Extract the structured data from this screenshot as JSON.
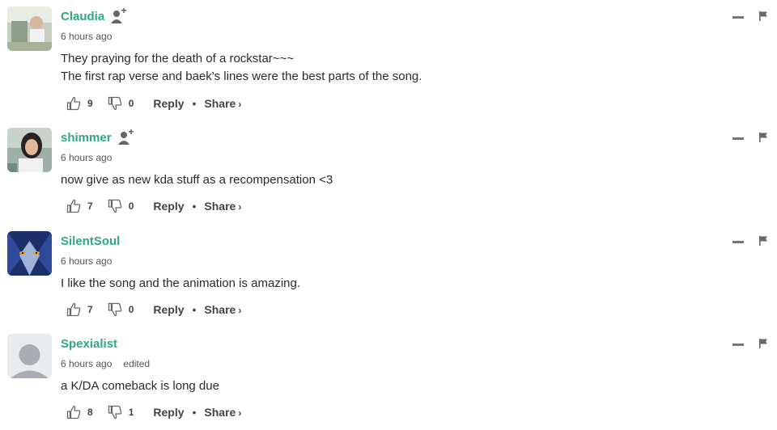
{
  "comments": [
    {
      "username": "Claudia",
      "time": "6 hours ago",
      "edited": "",
      "lines": [
        "They praying for the death of a rockstar~~~",
        "The first rap verse and baek's lines were the best parts of the song."
      ],
      "upvotes": "9",
      "downvotes": "0",
      "reply_label": "Reply",
      "share_label": "Share",
      "avatar_icon": "avatar-photo",
      "has_follow": true
    },
    {
      "username": "shimmer",
      "time": "6 hours ago",
      "edited": "",
      "lines": [
        "now give as new kda stuff as a recompensation <3"
      ],
      "upvotes": "7",
      "downvotes": "0",
      "reply_label": "Reply",
      "share_label": "Share",
      "avatar_icon": "avatar-photo",
      "has_follow": true
    },
    {
      "username": "SilentSoul",
      "time": "6 hours ago",
      "edited": "",
      "lines": [
        "I like the song and the animation is amazing."
      ],
      "upvotes": "7",
      "downvotes": "0",
      "reply_label": "Reply",
      "share_label": "Share",
      "avatar_icon": "wolf-avatar",
      "has_follow": false
    },
    {
      "username": "Spexialist",
      "time": "6 hours ago",
      "edited": "edited",
      "lines": [
        "a K/DA comeback is long due"
      ],
      "upvotes": "8",
      "downvotes": "1",
      "reply_label": "Reply",
      "share_label": "Share",
      "avatar_icon": "default-user-avatar",
      "has_follow": false
    }
  ],
  "colors": {
    "username": "#2ea87e",
    "text": "#2b2b2b",
    "muted": "#555555",
    "icon": "#777777"
  }
}
